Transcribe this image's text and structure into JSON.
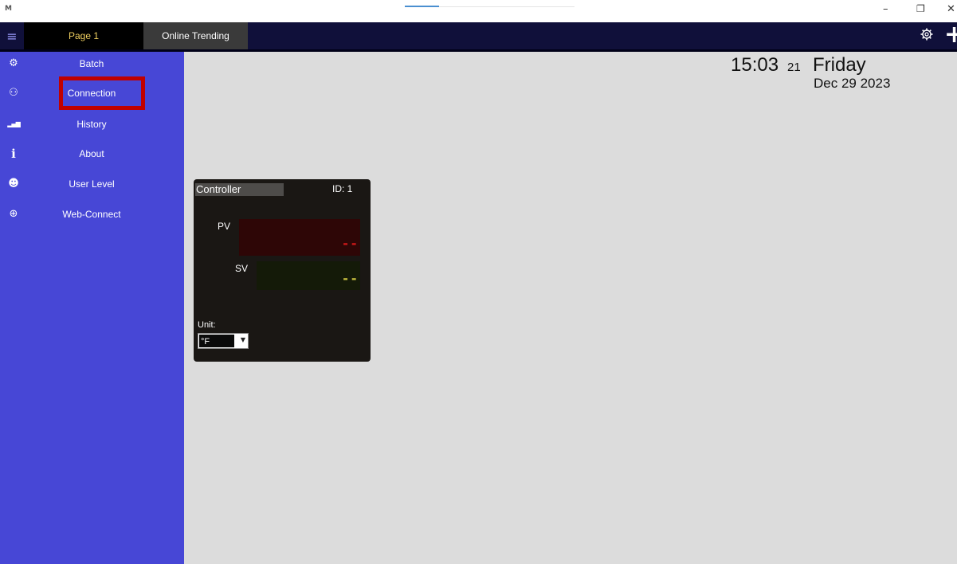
{
  "window": {
    "app_icon": "M",
    "minimize": "–",
    "maximize": "❐",
    "close": "✕"
  },
  "topbar": {
    "menu_icon": "≡",
    "tabs": [
      {
        "label": "Page 1",
        "active": true
      },
      {
        "label": "Online Trending",
        "active": false
      }
    ],
    "settings_icon": "gear-icon",
    "add_icon": "+"
  },
  "sidebar": {
    "items": [
      {
        "label": "Batch",
        "icon": "gears-icon",
        "glyph": "⚙"
      },
      {
        "label": "Connection",
        "icon": "share-icon",
        "glyph": "⚇",
        "highlighted": true
      },
      {
        "label": "History",
        "icon": "bar-chart-icon",
        "glyph": "▂▄▆"
      },
      {
        "label": "About",
        "icon": "info-icon",
        "glyph": "i"
      },
      {
        "label": "User Level",
        "icon": "users-icon",
        "glyph": "☻"
      },
      {
        "label": "Web-Connect",
        "icon": "globe-icon",
        "glyph": "⊕"
      }
    ]
  },
  "clock": {
    "time": "15:03",
    "seconds": "21",
    "day": "Friday",
    "date": "Dec 29 2023"
  },
  "controller": {
    "title": "Controller",
    "id_text": "ID: 1",
    "pv_label": "PV",
    "pv_value": "--",
    "sv_label": "SV",
    "sv_value": "--",
    "unit_label": "Unit:",
    "unit_value": "°F"
  },
  "colors": {
    "sidebar": "#4747d6",
    "topbar": "#10103a",
    "highlight": "#c00000",
    "pv_text": "#d01818",
    "sv_text": "#c8c040"
  }
}
